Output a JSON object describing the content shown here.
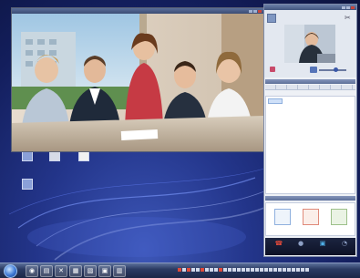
{
  "video_window": {
    "title": ""
  },
  "desktop_icons": [
    {
      "label": ""
    },
    {
      "label": ""
    },
    {
      "label": ""
    },
    {
      "label": ""
    }
  ],
  "panel": {
    "title": "",
    "user_name": "",
    "list_header": "",
    "tabs": [
      "",
      "",
      "",
      "",
      "",
      "",
      "",
      ""
    ],
    "contact": "",
    "apps_header": "",
    "apps": [
      {
        "label": "",
        "icon": "document-icon"
      },
      {
        "label": "",
        "icon": "whiteboard-icon"
      },
      {
        "label": "",
        "icon": "share-icon"
      }
    ],
    "bottom_buttons": [
      {
        "label": "",
        "icon": "phone-icon"
      },
      {
        "label": "",
        "icon": "microphone-icon"
      },
      {
        "label": "",
        "icon": "screen-icon"
      },
      {
        "label": "",
        "icon": "settings-icon"
      }
    ]
  },
  "taskbar": {
    "clock_time": "",
    "clock_date": ""
  },
  "colors": {
    "accent": "#3b4c74",
    "desktop_bg": "#131e5c",
    "tab_red": "#c8443a"
  }
}
